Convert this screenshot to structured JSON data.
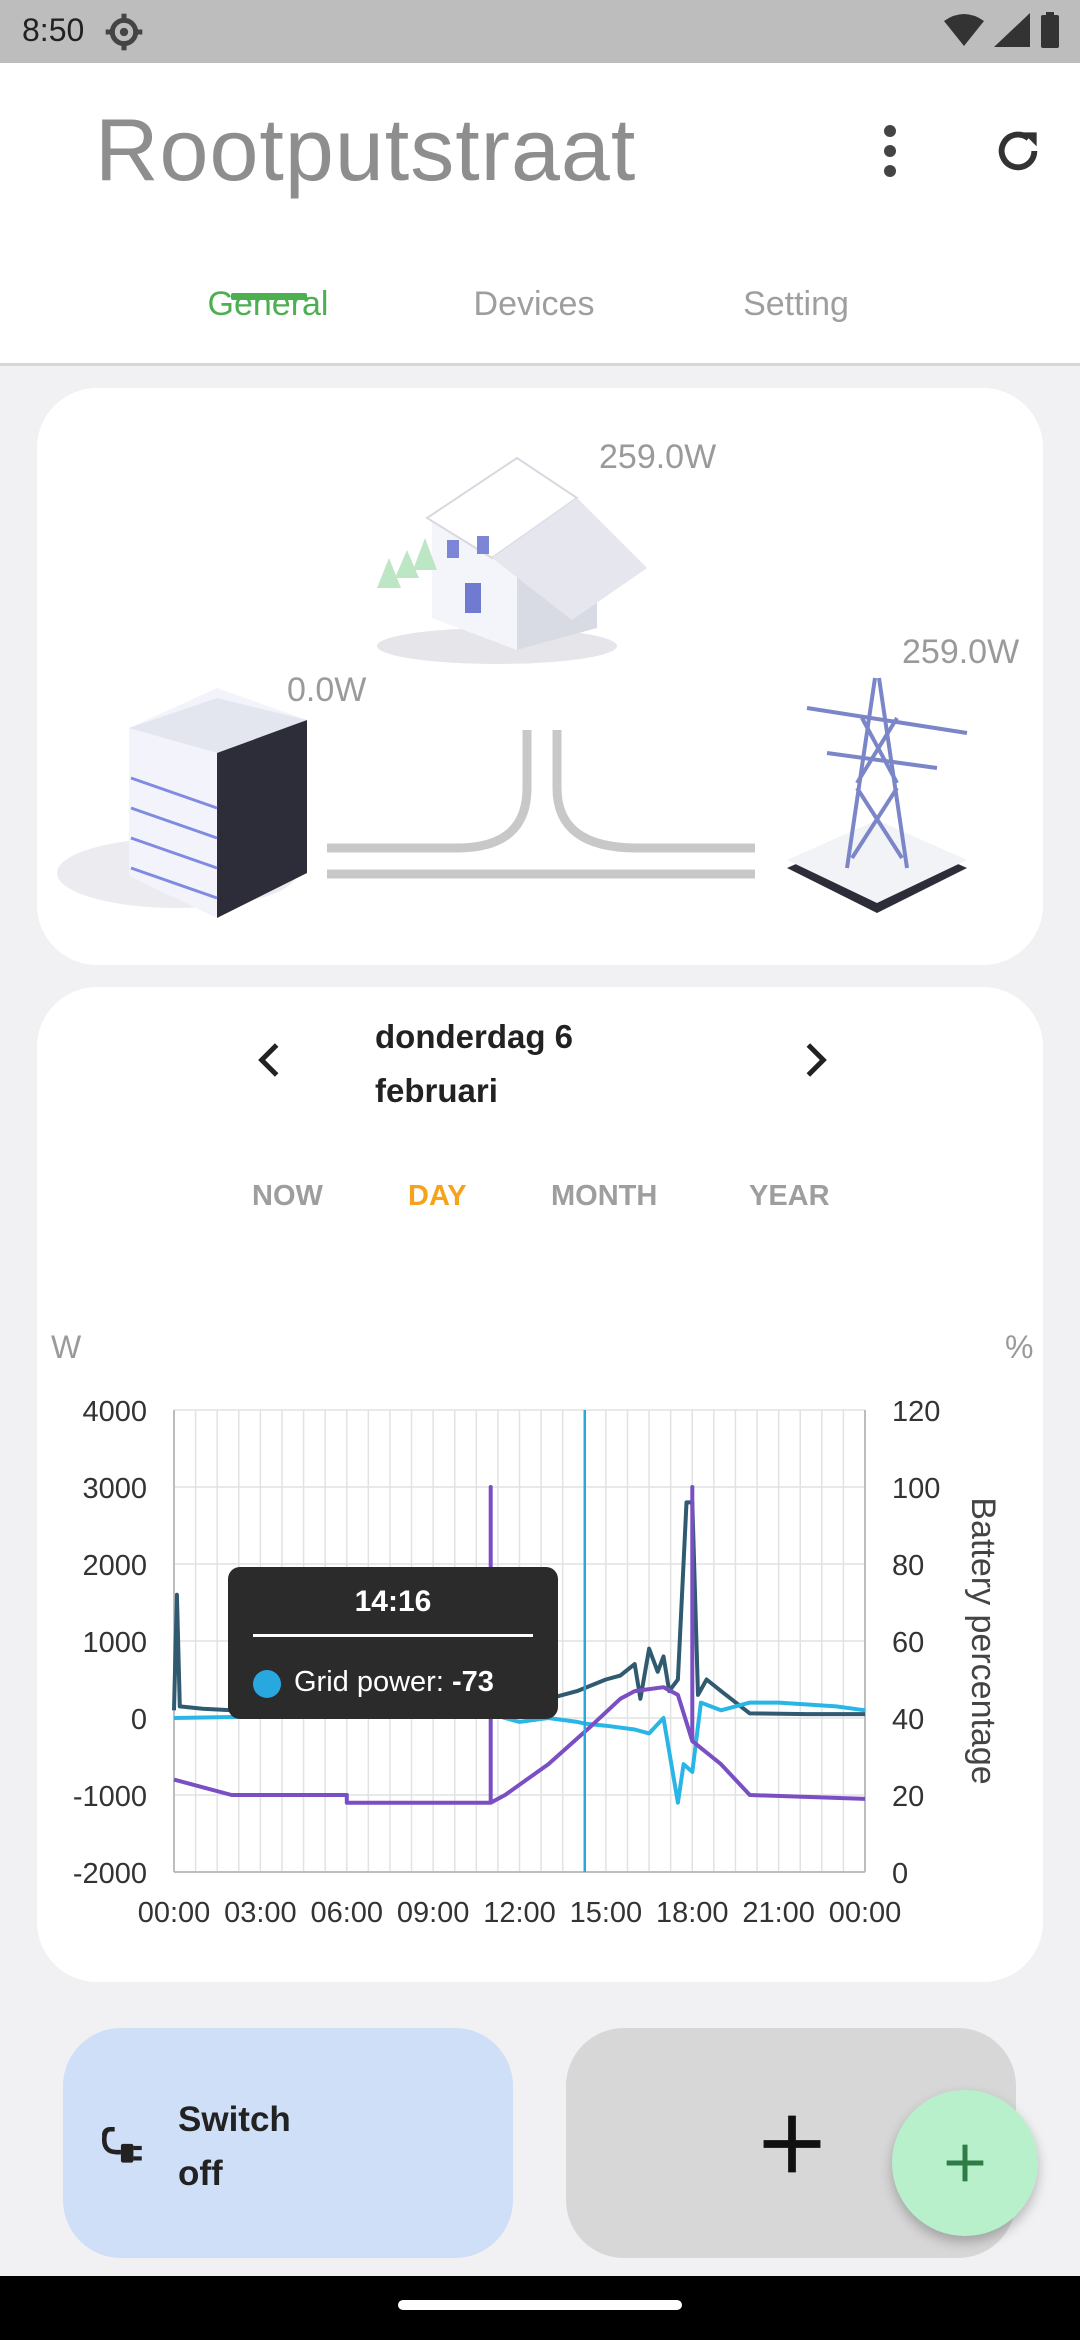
{
  "status_bar": {
    "time": "8:50"
  },
  "header": {
    "title": "Rootputstraat"
  },
  "tabs": [
    {
      "label": "General",
      "active": true
    },
    {
      "label": "Devices",
      "active": false
    },
    {
      "label": "Setting",
      "active": false
    }
  ],
  "energy": {
    "house_power": "259.0W",
    "grid_power": "259.0W",
    "battery_power": "0.0W"
  },
  "date_nav": {
    "line1": "donderdag 6",
    "line2": "februari"
  },
  "ranges": [
    {
      "label": "NOW",
      "active": false
    },
    {
      "label": "DAY",
      "active": true
    },
    {
      "label": "MONTH",
      "active": false
    },
    {
      "label": "YEAR",
      "active": false
    }
  ],
  "chart_data": {
    "type": "line",
    "left_unit": "W",
    "right_unit": "%",
    "ylabel_right": "Battery percentage",
    "ylim_left": [
      -2000,
      4000
    ],
    "ylim_right": [
      0,
      120
    ],
    "left_ticks": [
      "4000",
      "3000",
      "2000",
      "1000",
      "0",
      "-1000",
      "-2000"
    ],
    "right_ticks": [
      "120",
      "100",
      "80",
      "60",
      "40",
      "20",
      "0"
    ],
    "x_ticks": [
      "00:00",
      "03:00",
      "06:00",
      "09:00",
      "12:00",
      "15:00",
      "18:00",
      "21:00",
      "00:00"
    ],
    "grid": true,
    "cursor_time": "14:16",
    "tooltip": {
      "time": "14:16",
      "series": "Grid power",
      "value": "-73"
    },
    "series": [
      {
        "color": "#2f5a70",
        "points": [
          [
            0,
            100
          ],
          [
            0.1,
            1600
          ],
          [
            0.2,
            150
          ],
          [
            1,
            120
          ],
          [
            2,
            100
          ],
          [
            3,
            80
          ],
          [
            6,
            60
          ],
          [
            9,
            50
          ],
          [
            10.5,
            60
          ],
          [
            11,
            40
          ],
          [
            11.5,
            50
          ],
          [
            12,
            100
          ],
          [
            13,
            250
          ],
          [
            14,
            350
          ],
          [
            15,
            500
          ],
          [
            15.5,
            550
          ],
          [
            16,
            700
          ],
          [
            16.2,
            250
          ],
          [
            16.5,
            900
          ],
          [
            16.8,
            600
          ],
          [
            17,
            800
          ],
          [
            17.2,
            350
          ],
          [
            17.5,
            500
          ],
          [
            17.8,
            2800
          ],
          [
            18,
            2800
          ],
          [
            18.2,
            300
          ],
          [
            18.5,
            500
          ],
          [
            19,
            350
          ],
          [
            20,
            60
          ],
          [
            22,
            50
          ],
          [
            24,
            50
          ]
        ]
      },
      {
        "name": "Grid power",
        "color": "#29b6e6",
        "points": [
          [
            0,
            0
          ],
          [
            3,
            20
          ],
          [
            6,
            30
          ],
          [
            9,
            40
          ],
          [
            11,
            50
          ],
          [
            12,
            -50
          ],
          [
            13,
            0
          ],
          [
            14,
            -50
          ],
          [
            14.27,
            -73
          ],
          [
            15,
            -100
          ],
          [
            16,
            -150
          ],
          [
            16.5,
            -200
          ],
          [
            17,
            0
          ],
          [
            17.5,
            -1100
          ],
          [
            17.7,
            -600
          ],
          [
            18,
            -700
          ],
          [
            18.3,
            200
          ],
          [
            19,
            100
          ],
          [
            20,
            200
          ],
          [
            21,
            200
          ],
          [
            23,
            150
          ],
          [
            24,
            100
          ]
        ]
      },
      {
        "color": "#7b4fc4",
        "points": [
          [
            0,
            -800
          ],
          [
            1,
            -900
          ],
          [
            2,
            -1000
          ],
          [
            6,
            -1000
          ],
          [
            6,
            -1100
          ],
          [
            11,
            -1100
          ],
          [
            11,
            3000
          ],
          [
            11,
            -1100
          ],
          [
            11.5,
            -1000
          ],
          [
            13,
            -600
          ],
          [
            14.5,
            -100
          ],
          [
            15.5,
            250
          ],
          [
            16,
            350
          ],
          [
            17,
            400
          ],
          [
            17.5,
            300
          ],
          [
            18,
            -300
          ],
          [
            18,
            3000
          ],
          [
            18,
            -300
          ],
          [
            19,
            -600
          ],
          [
            20,
            -1000
          ],
          [
            24,
            -1050
          ]
        ]
      }
    ]
  },
  "buttons": {
    "switch_line1": "Switch",
    "switch_line2": "off"
  }
}
